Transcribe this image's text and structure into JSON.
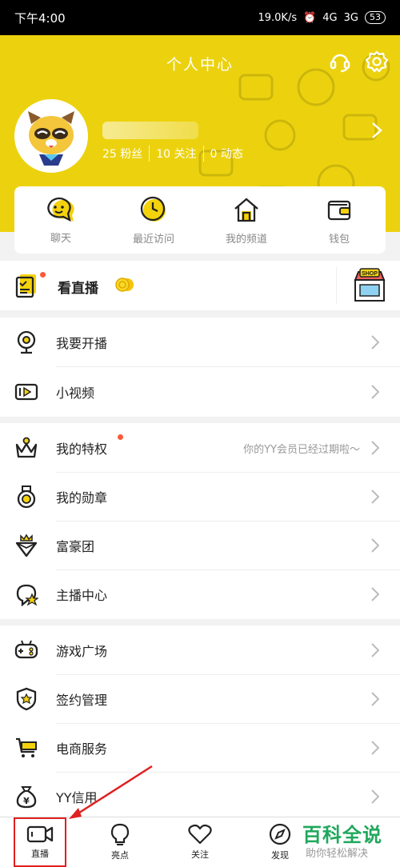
{
  "status_bar": {
    "time": "下午4:00",
    "speed": "19.0K/s",
    "net1": "4G",
    "net2": "3G",
    "battery": "53"
  },
  "header": {
    "title": "个人中心",
    "fans": "25 粉丝",
    "following": "10 关注",
    "posts": "0 动态"
  },
  "quick_actions": [
    {
      "label": "聊天",
      "icon": "chat-bubble-icon"
    },
    {
      "label": "最近访问",
      "icon": "clock-icon"
    },
    {
      "label": "我的频道",
      "icon": "home-icon"
    },
    {
      "label": "钱包",
      "icon": "wallet-icon"
    }
  ],
  "live_banner": {
    "label": "看直播"
  },
  "menu": {
    "start_live": "我要开播",
    "short_video": "小视频",
    "privileges": "我的特权",
    "privileges_sub": "你的YY会员已经过期啦～",
    "medals": "我的勋章",
    "rich_group": "富豪团",
    "anchor_center": "主播中心",
    "game_plaza": "游戏广场",
    "contract": "签约管理",
    "ecommerce": "电商服务",
    "yy_credit": "YY信用"
  },
  "tabs": [
    {
      "label": "直播",
      "active": true
    },
    {
      "label": "亮点",
      "active": false
    },
    {
      "label": "关注",
      "active": false
    },
    {
      "label": "发现",
      "active": false
    }
  ],
  "watermark": {
    "title": "百科全说",
    "subtitle": "助你轻松解决"
  },
  "colors": {
    "brand_yellow": "#ecd20e",
    "highlight_red": "#e02020",
    "badge_orange": "#ff5a36"
  }
}
